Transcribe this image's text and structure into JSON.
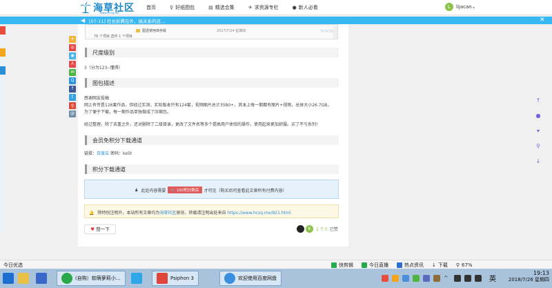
{
  "site": {
    "logo_text": "海草社区",
    "logo_url": "www.hcsq.me"
  },
  "nav": {
    "items": [
      {
        "label": "首页"
      },
      {
        "label": "好纸图包"
      },
      {
        "label": "精选合集"
      },
      {
        "label": "求资源专栏"
      },
      {
        "label": "新人必看"
      }
    ],
    "user": {
      "avatar_letter": "L",
      "name": "lijacan"
    }
  },
  "announcement": {
    "text": "[07-11] 社长折腾在外，搞关系的还…",
    "close": "✕"
  },
  "file_preview": {
    "folder_name": "图透使用库存版",
    "date": "2017/7/24 星期四",
    "status": "76 个项目    选中 1 个项目",
    "watermark": "www.hcsq"
  },
  "sections": [
    {
      "title": "尺度级别"
    },
    {
      "title": "图包描述"
    },
    {
      "title": "会员免积分下载通道"
    },
    {
      "title": "积分下载通道"
    }
  ],
  "scale_text": "3（分为123--懂得）",
  "description": {
    "line1": "感谢网友投稿",
    "line2": "网上有传是126套作品，但经过实测，实际版本只有124套，视频图片总计3580+，其本上每一期都有图片+视频，总体大小26.7GB，",
    "line3": "为了便于下载，每一期作品单独做成了压缩包。",
    "line4": "经过整理，除了去重之外，还对删除了二级目录，更改了文件名等多个提高用户体验的操作，使用起来更加舒服。买了不亏系列！"
  },
  "free_download": {
    "label": "链接：",
    "link": "百度云",
    "code": " 密码：ke5t"
  },
  "paid_download": {
    "prefix": "此处内容需要",
    "button": "150积分购买",
    "suffix": "才可见（购买后可查看此文章所有付费内容）"
  },
  "notice": {
    "prefix": "除特别注明外，本站所有文章均为",
    "site_link": "海草社区",
    "middle": "原创，转载请注明出处来自",
    "url": "https://www.hcsq.me/821.html"
  },
  "like": {
    "button": "赞一下",
    "avatar_letter": "K",
    "count": "2 个人",
    "suffix": "已赞"
  },
  "statusbar": {
    "left": "今日优选",
    "items": [
      {
        "label": "快剪辑",
        "color": "#2aa84a"
      },
      {
        "label": "今日直播",
        "color": "#2aa84a"
      },
      {
        "label": "热点资讯",
        "color": "#2a6ed8"
      },
      {
        "label": "下载",
        "color": "#444444"
      },
      {
        "label": "67%",
        "color": "#444444"
      }
    ]
  },
  "taskbar": {
    "apps": [
      {
        "label": "(自购）软萌萝莉小…",
        "color": "#2aa84a"
      },
      {
        "label": "Psiphon 3",
        "color": "#e0453a"
      },
      {
        "label": "欢迎使用百度网盘",
        "color": "#3a8ee0"
      }
    ],
    "ime": "英",
    "time": "19:13",
    "date": "2018/7/26 星期四"
  }
}
